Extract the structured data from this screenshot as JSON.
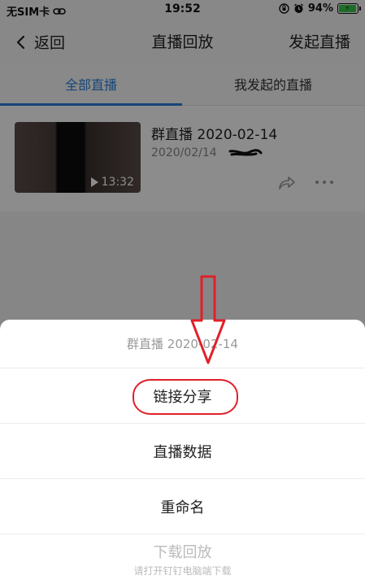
{
  "status_bar": {
    "carrier": "无SIM卡",
    "time": "19:52",
    "battery": "94%"
  },
  "nav": {
    "back_label": "返回",
    "title": "直播回放",
    "action_label": "发起直播"
  },
  "tabs": [
    {
      "label": "全部直播",
      "active": true
    },
    {
      "label": "我发起的直播",
      "active": false
    }
  ],
  "list": [
    {
      "title": "群直播 2020-02-14",
      "date": "2020/02/14",
      "duration": "13:32"
    }
  ],
  "sheet": {
    "title": "群直播 2020-02-14",
    "options": [
      {
        "label": "链接分享",
        "highlighted": true
      },
      {
        "label": "直播数据"
      },
      {
        "label": "重命名"
      },
      {
        "label": "下载回放",
        "disabled": true,
        "sublabel": "请打开钉钉电脑端下载"
      }
    ]
  },
  "colors": {
    "accent": "#2a7fdc",
    "annotation_red": "#e0202a"
  }
}
